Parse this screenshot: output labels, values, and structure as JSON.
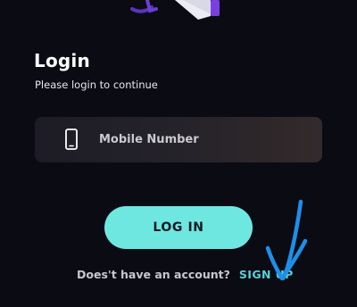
{
  "login": {
    "title": "Login",
    "subtitle": "Please login to continue"
  },
  "mobile_input": {
    "placeholder": "Mobile Number",
    "value": "",
    "icon": "mobile-phone-icon"
  },
  "login_button": {
    "label": "LOG IN"
  },
  "signup": {
    "question": "Does't have an account?",
    "link_label": "SIGN UP"
  },
  "colors": {
    "background": "#0b0b14",
    "accent": "#6fe7e1",
    "link": "#58d2d6",
    "annotation": "#1e8fe8"
  }
}
